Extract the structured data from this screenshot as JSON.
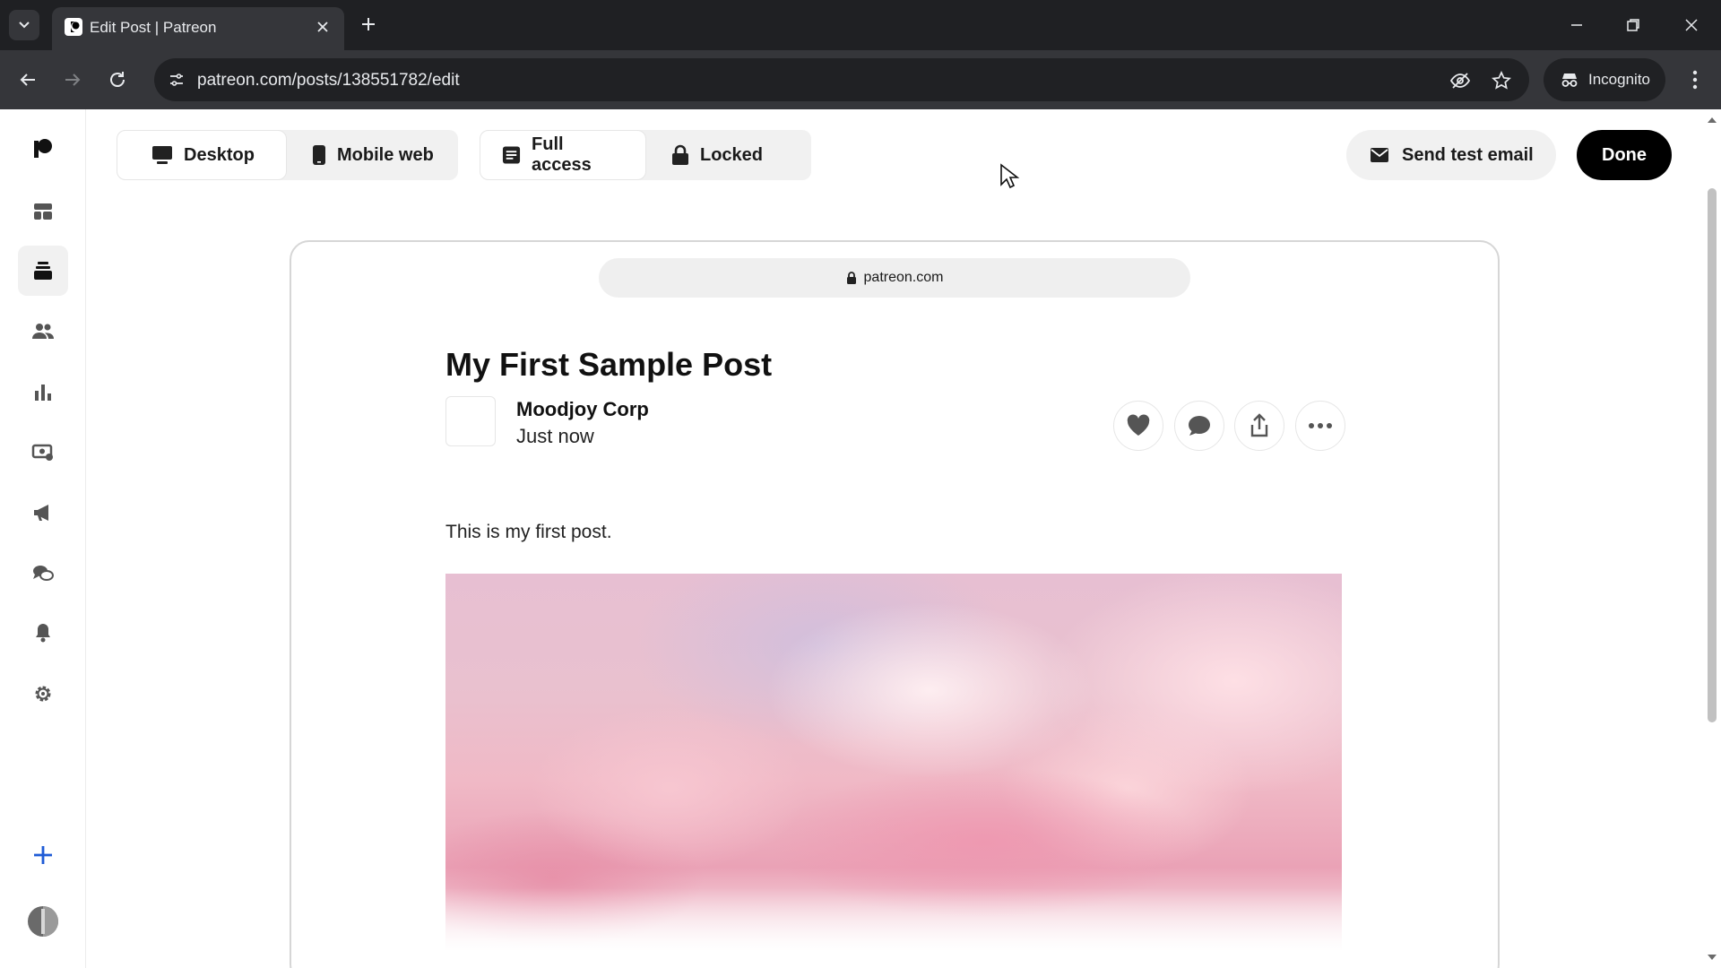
{
  "browser": {
    "tab_title": "Edit Post | Patreon",
    "url": "patreon.com/posts/138551782/edit",
    "incognito_label": "Incognito"
  },
  "controls": {
    "view_modes": [
      {
        "label": "Desktop",
        "icon": "desktop-icon",
        "selected": true
      },
      {
        "label": "Mobile web",
        "icon": "mobile-icon",
        "selected": false
      }
    ],
    "access_modes": [
      {
        "label": "Full access",
        "icon": "document-icon",
        "selected": true
      },
      {
        "label": "Locked",
        "icon": "lock-icon",
        "selected": false
      }
    ],
    "send_test_email": "Send test email",
    "done": "Done"
  },
  "sidebar": {
    "items": [
      {
        "name": "patreon-logo-icon"
      },
      {
        "name": "dashboard-icon"
      },
      {
        "name": "library-icon",
        "active": true
      },
      {
        "name": "audience-icon"
      },
      {
        "name": "insights-icon"
      },
      {
        "name": "payouts-icon"
      },
      {
        "name": "promotions-icon"
      },
      {
        "name": "chats-icon"
      },
      {
        "name": "notifications-icon"
      },
      {
        "name": "settings-icon"
      },
      {
        "name": "create-plus-icon"
      },
      {
        "name": "profile-avatar"
      }
    ]
  },
  "preview": {
    "domain": "patreon.com",
    "post": {
      "title": "My First Sample Post",
      "author": "Moodjoy Corp",
      "time": "Just now",
      "body": "This is my first post."
    }
  },
  "colors": {
    "chrome_dark": "#1f2023",
    "chrome_toolbar": "#35363a",
    "done_button": "#000000",
    "segment_bg": "#f1f1f1"
  }
}
